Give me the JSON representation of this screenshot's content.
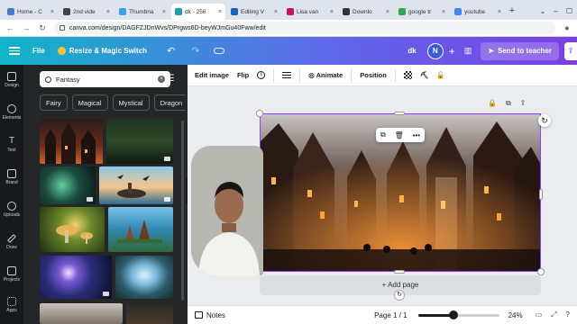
{
  "browser": {
    "tabs": [
      {
        "label": "Home - C",
        "color": "#4a7bd0",
        "active": false
      },
      {
        "label": "2nd vide",
        "color": "#444444",
        "active": false
      },
      {
        "label": "Thumbna",
        "color": "#3aa0e8",
        "active": false
      },
      {
        "label": "dk - 256",
        "color": "#1e9fb0",
        "active": true
      },
      {
        "label": "Editing V",
        "color": "#1565c0",
        "active": false
      },
      {
        "label": "Lisa van",
        "color": "#c2185b",
        "active": false
      },
      {
        "label": "Downlo",
        "color": "#333333",
        "active": false
      },
      {
        "label": "google tr",
        "color": "#34a853",
        "active": false
      },
      {
        "label": "youtube",
        "color": "#4285f4",
        "active": false
      }
    ],
    "tab_close": "×",
    "new_tab": "+",
    "url": "canva.com/design/DAGFZJDnWvs/DPrgws6D-beyWJmGu40Fww/edit",
    "window_controls": [
      "⌄",
      "–",
      "☐"
    ]
  },
  "canva_header": {
    "file_label": "File",
    "magic_label": "Resize & Magic Switch",
    "undo": "↶",
    "redo": "↷",
    "doc_name": "dk",
    "avatar_initial": "N",
    "add": "+",
    "send_label": "Send to teacher"
  },
  "rail": {
    "items": [
      {
        "label": "Design",
        "active": false
      },
      {
        "label": "Elements",
        "active": false
      },
      {
        "label": "Text",
        "active": false
      },
      {
        "label": "Brand",
        "active": false
      },
      {
        "label": "Uploads",
        "active": false
      },
      {
        "label": "Draw",
        "active": false
      },
      {
        "label": "Projects",
        "active": false
      },
      {
        "label": "Apps",
        "active": false
      }
    ]
  },
  "panel": {
    "search_value": "Fantasy",
    "clear_glyph": "×",
    "filter_glyph": "☰",
    "chips": [
      "Fairy",
      "Magical",
      "Mystical",
      "Dragon"
    ]
  },
  "editor_toolbar": {
    "edit_image": "Edit image",
    "flip": "Flip",
    "info_glyph": "i",
    "animate": "Animate",
    "position": "Position"
  },
  "float_menu": [
    "⧉",
    "🗑",
    "•••"
  ],
  "rotate_glyph": "↻",
  "add_page": "+ Add page",
  "page_cycle_glyph": "↻",
  "footer": {
    "notes": "Notes",
    "page_indicator": "Page 1 / 1",
    "zoom_value": "24%",
    "zoom_fraction": 0.24,
    "icons": [
      "▭",
      "⤢",
      "?"
    ]
  },
  "colors": {
    "canva_gradient_start": "#10b5c7",
    "canva_gradient_end": "#7b3fe4",
    "selection": "#8b3dff",
    "panel_bg": "#252627",
    "rail_bg": "#18191b"
  }
}
